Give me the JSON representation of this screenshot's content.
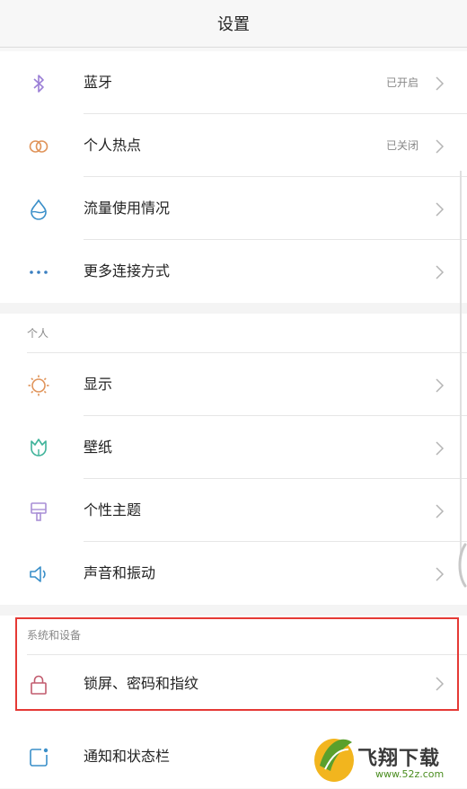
{
  "header": {
    "title": "设置"
  },
  "connections": [
    {
      "name": "bluetooth",
      "icon": "bluetooth-icon",
      "label": "蓝牙",
      "status": "已开启"
    },
    {
      "name": "hotspot",
      "icon": "hotspot-icon",
      "label": "个人热点",
      "status": "已关闭"
    },
    {
      "name": "data-usage",
      "icon": "water-drop-icon",
      "label": "流量使用情况",
      "status": ""
    },
    {
      "name": "more-connections",
      "icon": "more-dots-icon",
      "label": "更多连接方式",
      "status": ""
    }
  ],
  "personal": {
    "title": "个人",
    "items": [
      {
        "name": "display",
        "icon": "sun-icon",
        "label": "显示"
      },
      {
        "name": "wallpaper",
        "icon": "tulip-icon",
        "label": "壁纸"
      },
      {
        "name": "theme",
        "icon": "brush-icon",
        "label": "个性主题"
      },
      {
        "name": "sound",
        "icon": "speaker-icon",
        "label": "声音和振动"
      }
    ]
  },
  "system": {
    "title": "系统和设备",
    "items": [
      {
        "name": "lock-screen",
        "icon": "lock-icon",
        "label": "锁屏、密码和指纹"
      },
      {
        "name": "notifications",
        "icon": "notification-icon",
        "label": "通知和状态栏"
      }
    ]
  },
  "watermark": {
    "text": "飞翔下载",
    "url": "www.52z.com"
  },
  "colors": {
    "highlight": "#e53935",
    "bluetooth": "#9b7fd6",
    "hotspot": "#e0945a",
    "drop": "#3a8fc9",
    "dots": "#3a7fc0",
    "sun": "#e0945a",
    "tulip": "#3fb39a",
    "brush": "#a98fd6",
    "speaker": "#3a8fc9",
    "lock": "#c25b6e",
    "notify": "#3a8fc9"
  }
}
